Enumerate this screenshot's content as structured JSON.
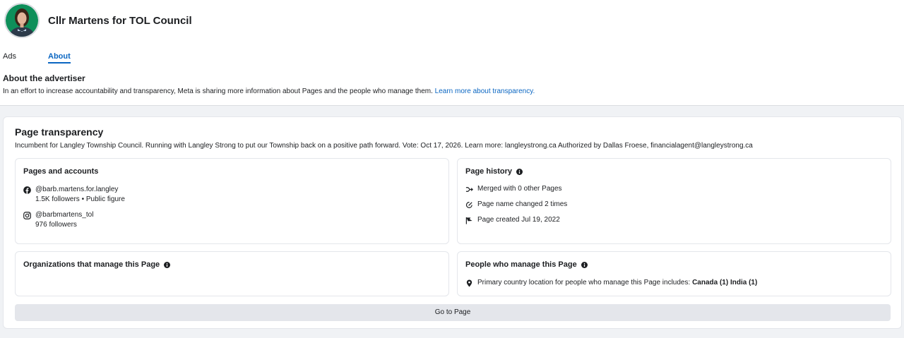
{
  "page": {
    "name": "Cllr Martens for TOL Council"
  },
  "tabs": {
    "ads": "Ads",
    "about": "About"
  },
  "about": {
    "title": "About the advertiser",
    "description": "In an effort to increase accountability and transparency, Meta is sharing more information about Pages and the people who manage them.",
    "link": "Learn more about transparency."
  },
  "transparency": {
    "title": "Page transparency",
    "description": "Incumbent for Langley Township Council. Running with Langley Strong to put our Township back on a positive path forward. Vote: Oct 17, 2026. Learn more: langleystrong.ca Authorized by Dallas Froese, financialagent@langleystrong.ca",
    "accounts": {
      "title": "Pages and accounts",
      "facebook_handle": "@barb.martens.for.langley",
      "facebook_meta": "1.5K followers • Public figure",
      "instagram_handle": "@barbmartens_tol",
      "instagram_meta": "976 followers"
    },
    "history": {
      "title": "Page history",
      "merged": "Merged with 0 other Pages",
      "name_changed": "Page name changed 2 times",
      "created": "Page created Jul 19, 2022"
    },
    "organizations": {
      "title": "Organizations that manage this Page"
    },
    "people": {
      "title": "People who manage this Page",
      "location_text": "Primary country location for people who manage this Page includes:",
      "countries": "Canada (1) India (1)"
    },
    "go_button": "Go to Page"
  },
  "colors": {
    "link": "#0a66c2",
    "background": "#f0f2f5",
    "button": "#e4e6eb"
  },
  "icons": [
    "facebook-icon",
    "instagram-icon",
    "merge-icon",
    "rename-icon",
    "flag-icon",
    "location-pin-icon",
    "info-icon"
  ]
}
